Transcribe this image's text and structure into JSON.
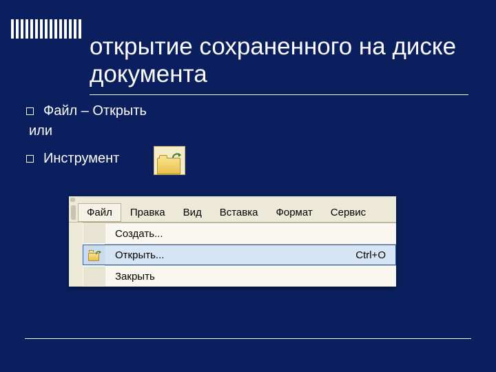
{
  "slide": {
    "title": "открытие сохраненного на диске документа",
    "bullet1": "Файл – Открыть",
    "or": "или",
    "bullet2": "Инструмент"
  },
  "menubar": {
    "items": [
      {
        "label": "Файл",
        "active": true
      },
      {
        "label": "Правка"
      },
      {
        "label": "Вид"
      },
      {
        "label": "Вставка"
      },
      {
        "label": "Формат"
      },
      {
        "label": "Сервис"
      }
    ]
  },
  "dropdown": {
    "items": [
      {
        "label": "Создать...",
        "shortcut": "",
        "icon": "none",
        "highlight": false
      },
      {
        "label": "Открыть...",
        "shortcut": "Ctrl+O",
        "icon": "folder-open",
        "highlight": true
      },
      {
        "label": "Закрыть",
        "shortcut": "",
        "icon": "none",
        "highlight": false
      }
    ]
  },
  "colors": {
    "background": "#0b1f5e",
    "toolbarBg": "#ece9d8",
    "highlightBorder": "#2a5db0",
    "highlightFill": "#d6e5f5"
  }
}
